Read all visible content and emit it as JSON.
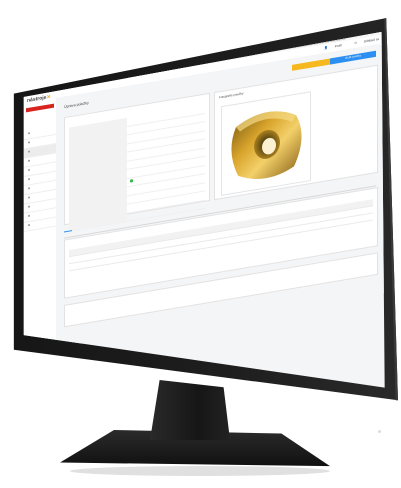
{
  "browser": {
    "tab_title": "Nástrojomat",
    "url": "nastroje.cz",
    "search_placeholder": "Hľadať",
    "window_controls": "– □ ×",
    "nav_glyphs": "‹ › ⟳",
    "toolbar_glyphs": "☆ ⚙ ⌂",
    "ext_glyphs": "⋯ ★ ☰"
  },
  "app": {
    "logo_text": "nástroje",
    "brand_color": "#f2a81d",
    "sidebar": {
      "badge": "",
      "sub1": "",
      "sub2": "",
      "items": [
        {
          "label": ""
        },
        {
          "label": ""
        },
        {
          "label": ""
        },
        {
          "label": ""
        },
        {
          "label": ""
        },
        {
          "label": ""
        },
        {
          "label": ""
        },
        {
          "label": ""
        },
        {
          "label": ""
        },
        {
          "label": ""
        },
        {
          "label": ""
        }
      ]
    },
    "topnav": {
      "links": [
        "",
        "",
        "",
        ""
      ],
      "user": "Profil",
      "logout": "Odhlásiť sa"
    },
    "page": {
      "title": "Úprava položky",
      "add_button": "",
      "save_button": "Uložiť položku"
    },
    "details": {
      "heading": "",
      "rows": [
        {
          "label": "",
          "value": ""
        },
        {
          "label": "",
          "value": ""
        },
        {
          "label": "",
          "value": ""
        },
        {
          "label": "",
          "value": ""
        },
        {
          "label": "",
          "value": ""
        },
        {
          "label": "",
          "value": ""
        },
        {
          "label": "",
          "value": ""
        },
        {
          "label": "",
          "value": ""
        },
        {
          "label": "",
          "value": ""
        },
        {
          "label": "",
          "value": ""
        },
        {
          "label": "",
          "value": ""
        },
        {
          "label": "",
          "value": ""
        }
      ]
    },
    "image_panel": {
      "heading": "Fotografie položky",
      "sub": ""
    },
    "tabs": [
      "",
      "",
      "",
      "",
      ""
    ],
    "grid": {
      "title": "",
      "header": [
        "",
        "",
        "",
        "",
        "",
        "",
        "",
        ""
      ],
      "rows": [
        [
          "",
          "",
          "",
          "",
          "",
          "",
          "",
          ""
        ],
        [
          "",
          "",
          "",
          "",
          "",
          "",
          "",
          ""
        ]
      ]
    },
    "footer_text": ""
  }
}
